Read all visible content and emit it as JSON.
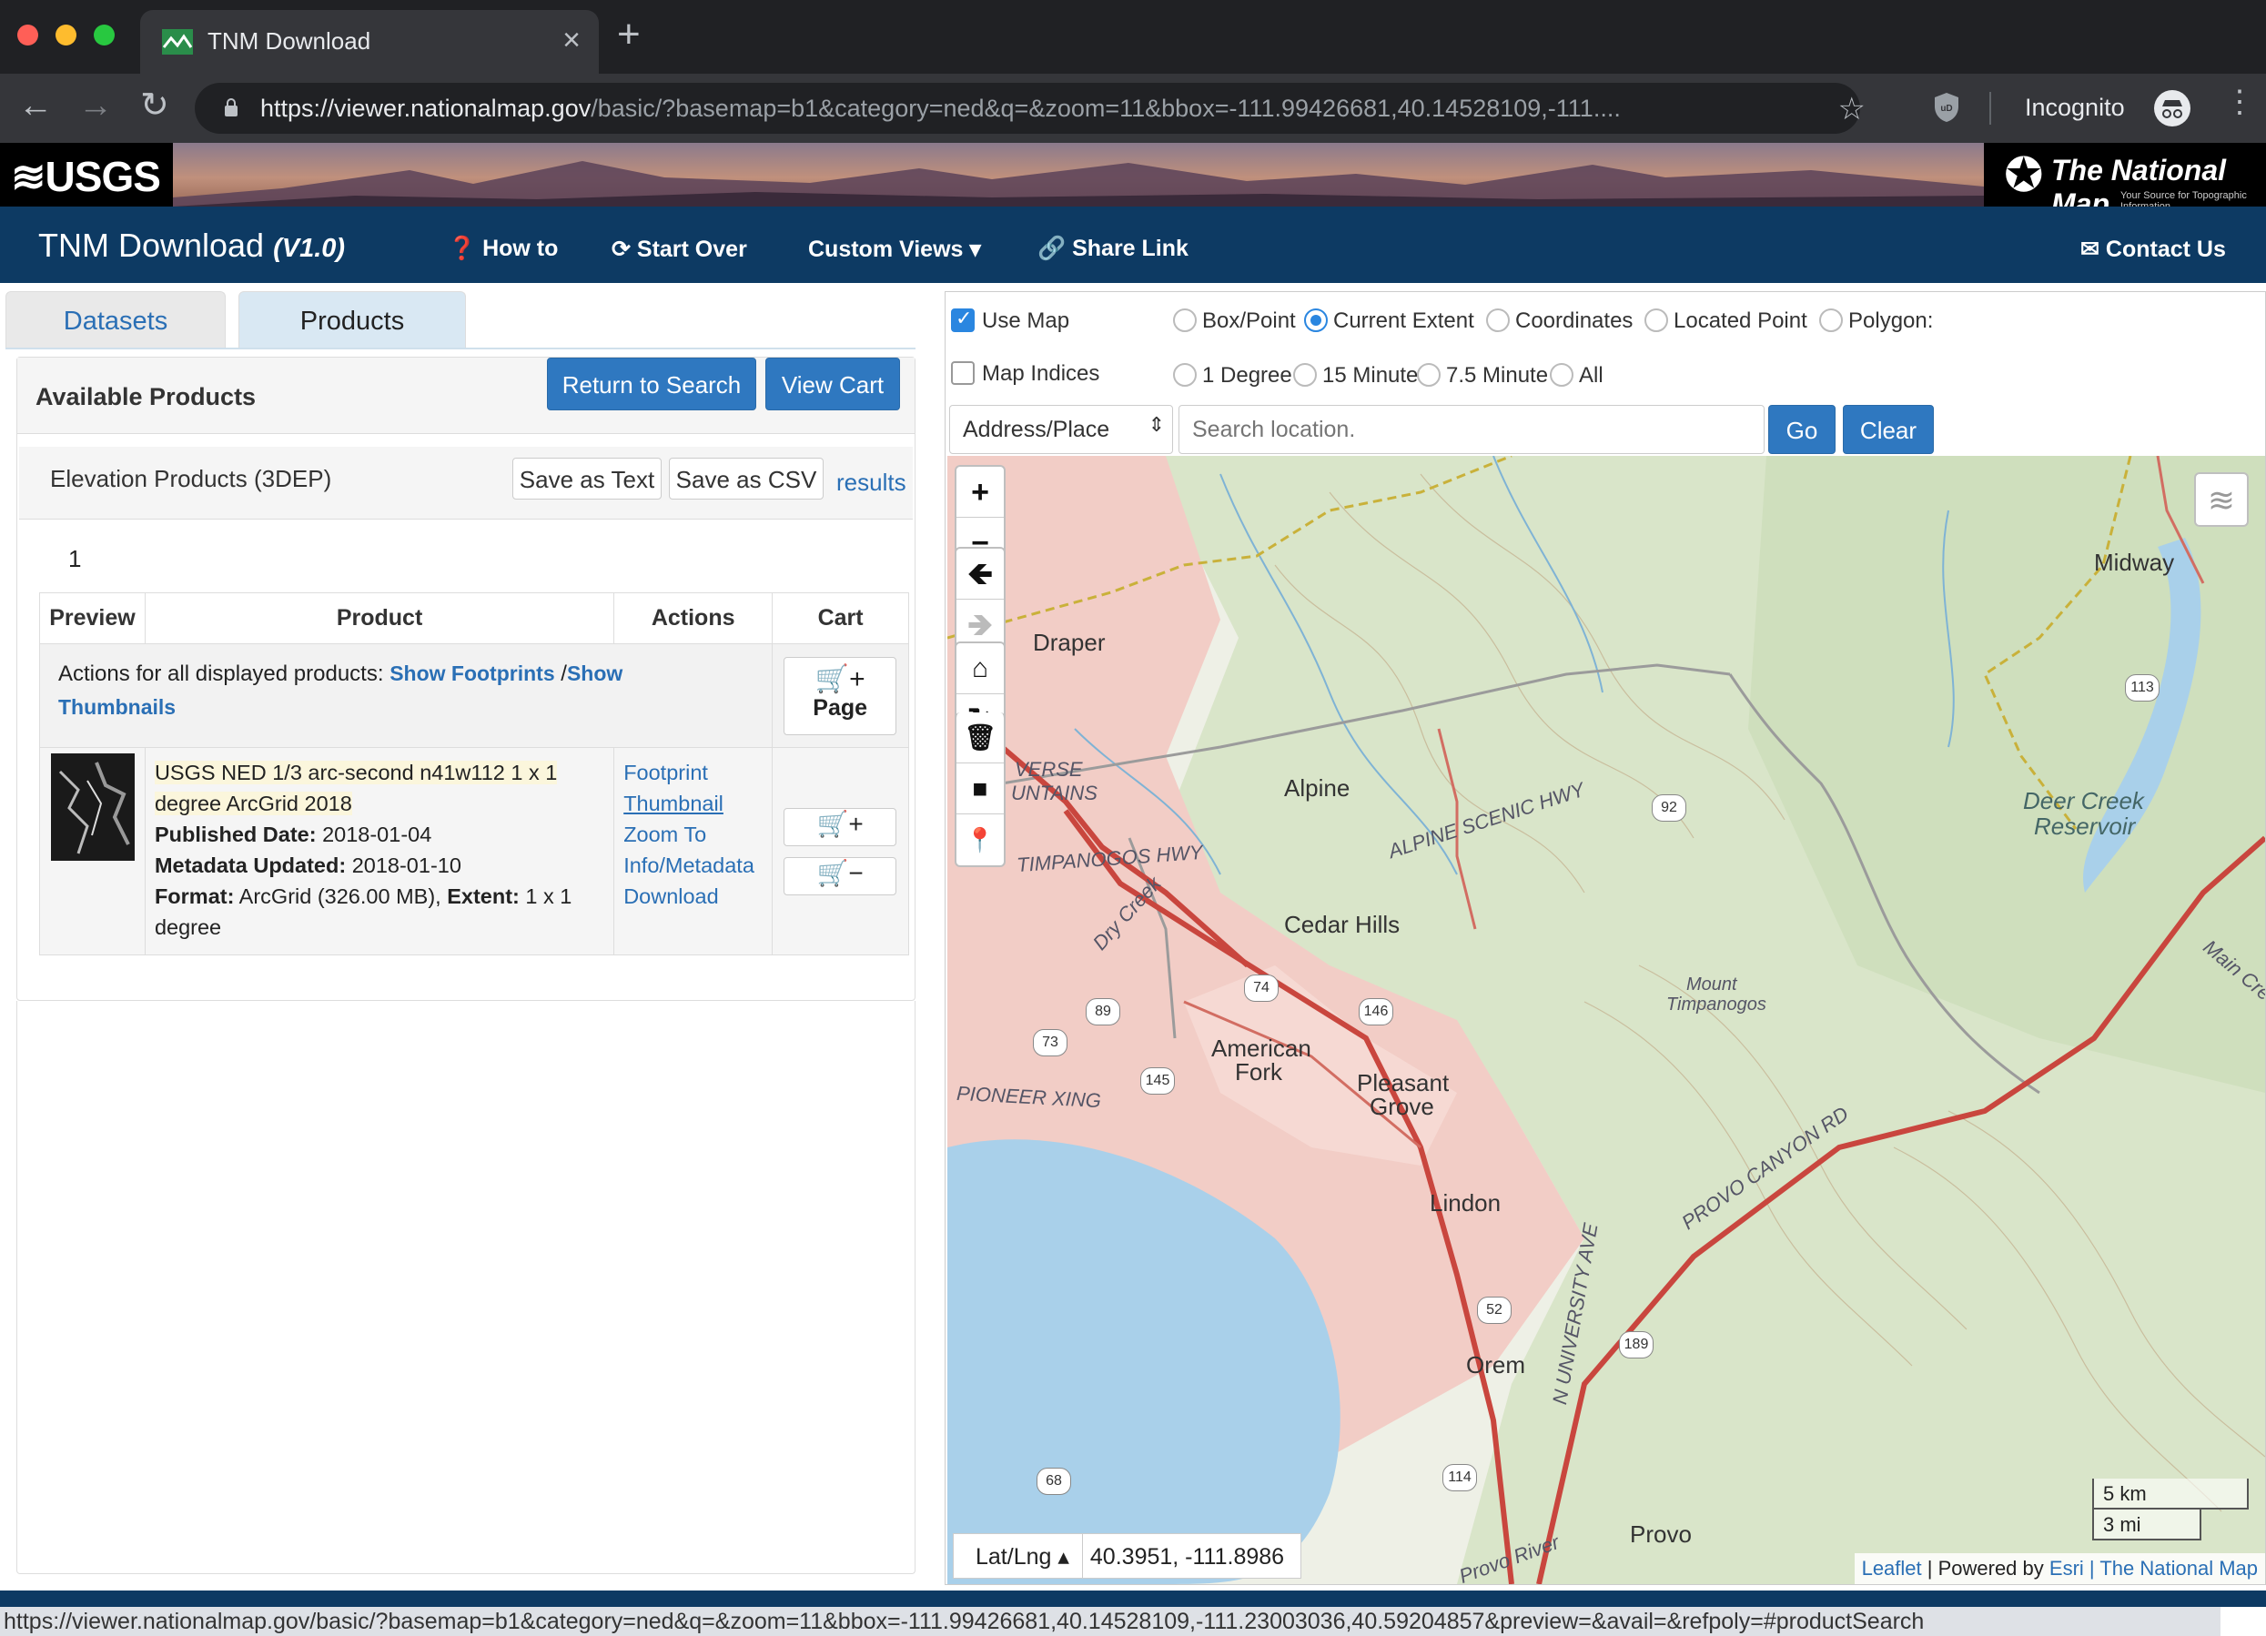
{
  "browser": {
    "tab_title": "TNM Download",
    "url_host": "https://viewer.nationalmap.gov",
    "url_rest": "/basic/?basemap=b1&category=ned&q=&zoom=11&bbox=-111.99426681,40.14528109,-111....",
    "profile": "Incognito",
    "status_url": "https://viewer.nationalmap.gov/basic/?basemap=b1&category=ned&q=&zoom=11&bbox=-111.99426681,40.14528109,-111.23003036,40.59204857&preview=&avail=&refpoly=#productSearch"
  },
  "banner": {
    "left_logo": "≋USGS",
    "right_logo": "The National Map",
    "right_tagline": "Your Source for Topographic Information"
  },
  "appnav": {
    "title": "TNM Download",
    "version": "(V1.0)",
    "howto": "How to",
    "startover": "Start Over",
    "customviews": "Custom Views",
    "sharelink": "Share Link",
    "contact": "Contact Us"
  },
  "left": {
    "tab_datasets": "Datasets",
    "tab_products": "Products",
    "available": "Available Products",
    "return_btn": "Return to Search",
    "cart_btn": "View Cart",
    "section_title": "Elevation Products (3DEP)",
    "save_text": "Save as Text",
    "save_csv": "Save as CSV",
    "results": "results",
    "page": "1",
    "columns": [
      "Preview",
      "Product",
      "Actions",
      "Cart"
    ],
    "all_actions_label": "Actions for all displayed products:",
    "show_footprints": "Show Footprints",
    "slash": "/",
    "show": "Show",
    "thumbnails": "Thumbnails",
    "page_btn": "Page",
    "product": {
      "title_line1": "USGS NED 1/3 arc-second n41w112 1 x 1",
      "title_line2": "degree ArcGrid 2018",
      "published_label": "Published Date:",
      "published": "2018-01-04",
      "metadata_label": "Metadata Updated:",
      "metadata": "2018-01-10",
      "format_label": "Format:",
      "format": "ArcGrid (326.00 MB),",
      "extent_label": "Extent:",
      "extent_line1": "1 x 1",
      "extent_line2": "degree",
      "actions": [
        "Footprint",
        "Thumbnail",
        "Zoom To",
        "Info/Metadata",
        "Download"
      ]
    }
  },
  "mapopts": {
    "use_map": "Use Map",
    "use_map_checked": true,
    "map_indices": "Map Indices",
    "map_indices_checked": false,
    "modes": [
      "Box/Point",
      "Current Extent",
      "Coordinates",
      "Located Point",
      "Polygon:"
    ],
    "mode_selected": "Current Extent",
    "indices": [
      "1 Degree",
      "15 Minute",
      "7.5 Minute",
      "All"
    ],
    "select_value": "Address/Place",
    "search_placeholder": "Search location.",
    "go": "Go",
    "clear": "Clear"
  },
  "map": {
    "labels": [
      "Draper",
      "Alpine",
      "Cedar Hills",
      "American",
      "Fork",
      "Pleasant",
      "Grove",
      "Lindon",
      "Orem",
      "Provo",
      "Midway",
      "Deer Creek",
      "Reservoir"
    ],
    "road_labels": [
      "TIMPANOGOS HWY",
      "ALPINE SCENIC HWY",
      "PROVO CANYON RD",
      "PIONEER XING",
      "N UNIVERSITY AVE",
      "Dry Creek",
      "Main Creek",
      "Provo River",
      "Mount",
      "Timpanogos",
      "VERSE",
      "UNTAINS"
    ],
    "shields": [
      "92",
      "74",
      "89",
      "146",
      "73",
      "145",
      "52",
      "189",
      "68",
      "114",
      "113"
    ],
    "coord_mode": "Lat/Lng ▴",
    "coords": "40.3951, -111.8986",
    "scale_km": "5 km",
    "scale_mi": "3 mi",
    "attr_leaflet": "Leaflet",
    "attr_powered": "| Powered by",
    "attr_esri": "Esri",
    "attr_tnm": "| The National Map",
    "colors": {
      "urban": "#f2c8c2",
      "forest": "#d7e3c6",
      "water": "#a9d0ea",
      "highway": "#c9463e"
    }
  }
}
